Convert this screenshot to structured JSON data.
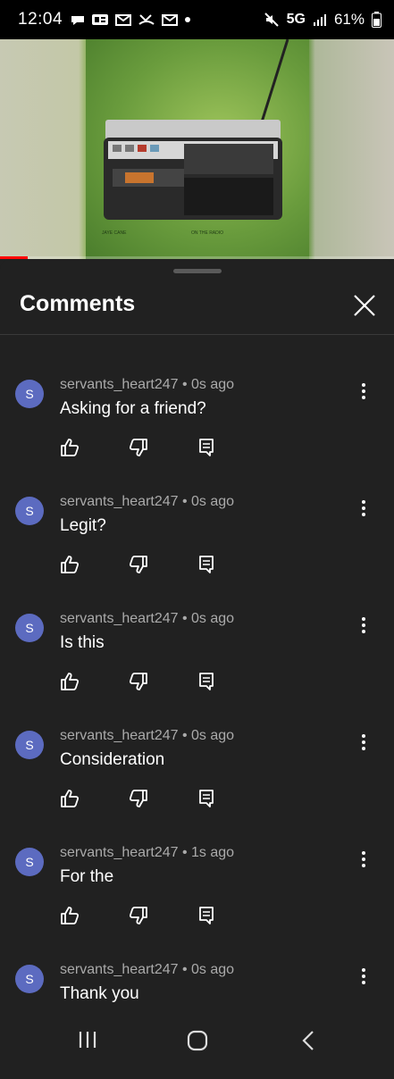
{
  "status_bar": {
    "time": "12:04",
    "network": "5G",
    "battery": "61%",
    "icons": [
      "chat-icon",
      "news-icon",
      "gmail-icon",
      "missed-call-icon",
      "gmail-icon",
      "dot-icon",
      "mute-icon",
      "signal-icon",
      "battery-icon"
    ]
  },
  "video": {
    "progress": 0.07,
    "accent": "#ff0000"
  },
  "sheet": {
    "title": "Comments",
    "close_icon": "close-icon"
  },
  "comments": [
    {
      "avatar": "S",
      "author": "servants_heart247",
      "time": "0s ago",
      "text": "Asking for a friend?"
    },
    {
      "avatar": "S",
      "author": "servants_heart247",
      "time": "0s ago",
      "text": "Legit?"
    },
    {
      "avatar": "S",
      "author": "servants_heart247",
      "time": "0s ago",
      "text": "Is this"
    },
    {
      "avatar": "S",
      "author": "servants_heart247",
      "time": "0s ago",
      "text": "Consideration"
    },
    {
      "avatar": "S",
      "author": "servants_heart247",
      "time": "1s ago",
      "text": "For the"
    },
    {
      "avatar": "S",
      "author": "servants_heart247",
      "time": "0s ago",
      "text": "Thank you"
    }
  ],
  "colors": {
    "background": "#212121",
    "avatar": "#5c6bc0",
    "meta": "#aaaaaa"
  },
  "nav": {
    "icons": [
      "recent-apps-icon",
      "home-icon",
      "back-icon"
    ]
  }
}
